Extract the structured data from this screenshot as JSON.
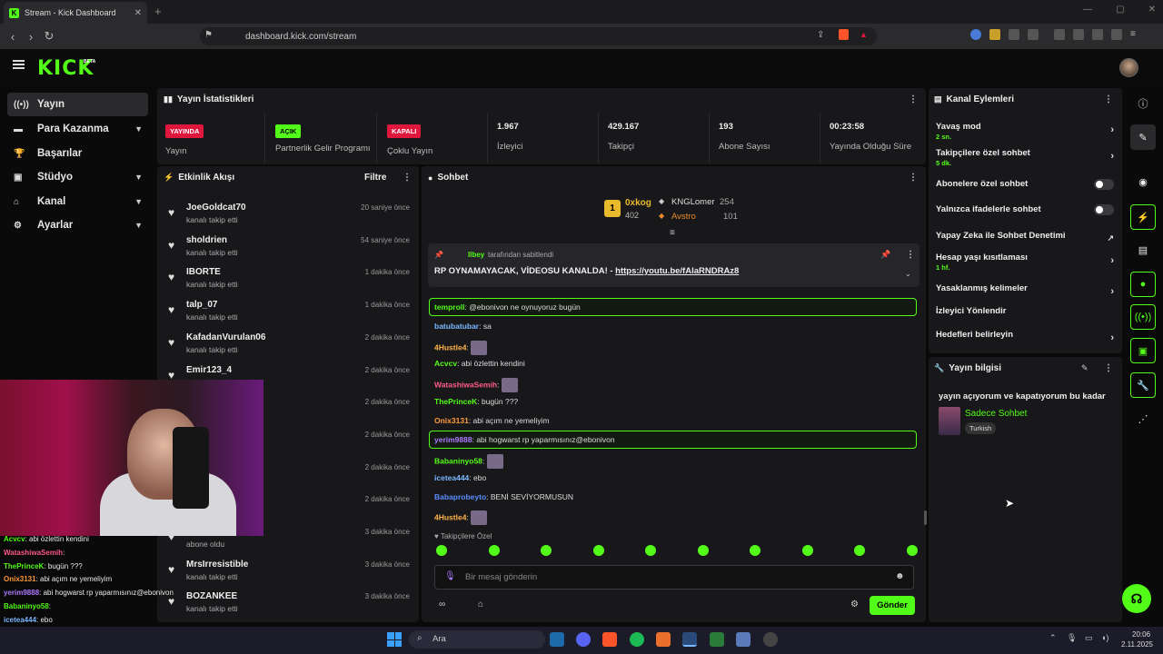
{
  "browser": {
    "tab_title": "Stream - Kick Dashboard",
    "url": "dashboard.kick.com/stream"
  },
  "brand": {
    "logo": "KICK",
    "beta": "BETA",
    "accent": "#53fc18"
  },
  "sidebar": {
    "items": [
      {
        "label": "Yayın",
        "icon": "broadcast-icon"
      },
      {
        "label": "Para Kazanma",
        "icon": "money-icon"
      },
      {
        "label": "Başarılar",
        "icon": "trophy-icon"
      },
      {
        "label": "Stüdyo",
        "icon": "studio-icon"
      },
      {
        "label": "Kanal",
        "icon": "channel-icon"
      },
      {
        "label": "Ayarlar",
        "icon": "gear-icon"
      }
    ]
  },
  "stats": {
    "title": "Yayın İstatistikleri",
    "cells": [
      {
        "badge": "YAYINDA",
        "badge_color": "#e0173d",
        "label": "Yayın"
      },
      {
        "badge": "AÇIK",
        "badge_color": "#53fc18",
        "label": "Partnerlik Gelir Programı"
      },
      {
        "badge": "KAPALI",
        "badge_color": "#e0173d",
        "label": "Çoklu Yayın"
      },
      {
        "value": "1.967",
        "label": "İzleyici"
      },
      {
        "value": "429.167",
        "label": "Takipçi"
      },
      {
        "value": "193",
        "label": "Abone Sayısı"
      },
      {
        "value": "00:23:58",
        "label": "Yayında Olduğu Süre"
      }
    ]
  },
  "activity": {
    "title": "Etkinlik Akışı",
    "filter": "Filtre",
    "items": [
      {
        "name": "JoeGoldcat70",
        "sub": "kanalı takip etti",
        "time": "20 saniye önce"
      },
      {
        "name": "sholdrien",
        "sub": "kanalı takip etti",
        "time": "54 saniye önce"
      },
      {
        "name": "IBORTE",
        "sub": "kanalı takip etti",
        "time": "1 dakika önce"
      },
      {
        "name": "talp_07",
        "sub": "kanalı takip etti",
        "time": "1 dakika önce"
      },
      {
        "name": "KafadanVurulan06",
        "sub": "kanalı takip etti",
        "time": "2 dakika önce"
      },
      {
        "name": "Emir123_4",
        "sub": "kanalı takip etti",
        "time": "2 dakika önce"
      },
      {
        "name": "",
        "sub": "",
        "time": "2 dakika önce"
      },
      {
        "name": "",
        "sub": "",
        "time": "2 dakika önce"
      },
      {
        "name": "",
        "sub": "",
        "time": "2 dakika önce"
      },
      {
        "name": "",
        "sub": "",
        "time": "2 dakika önce"
      },
      {
        "name": "",
        "sub": "abone oldu",
        "time": "3 dakika önce"
      },
      {
        "name": "MrsIrresistible",
        "sub": "kanalı takip etti",
        "time": "3 dakika önce"
      },
      {
        "name": "BOZANKEE",
        "sub": "kanalı takip etti",
        "time": "3 dakika önce"
      }
    ]
  },
  "chat": {
    "title": "Sohbet",
    "leader": {
      "rank": "1",
      "name1": "0xkog",
      "val1": "402",
      "name2": "KNGLomer",
      "val2": "254",
      "name3": "Avstro",
      "val3": "101"
    },
    "pinned": {
      "by": "llbey",
      "by_suffix": "tarafından sabitlendi",
      "text": "RP OYNAMAYACAK, VİDEOSU KANALDA! - ",
      "link": "https://youtu.be/fAlaRNDRAz8"
    },
    "messages": [
      {
        "user": "temproll",
        "color": "#53fc18",
        "text": "@ebonivon ne oynuyoruz bugün",
        "highlight": true
      },
      {
        "user": "batubatubar",
        "color": "#7ab8ff",
        "text": "sa"
      },
      {
        "user": "4Hustle4",
        "color": "#ffb347",
        "text": "",
        "emote": true
      },
      {
        "user": "Acvcv",
        "color": "#53fc18",
        "text": "abi özlettin kendini"
      },
      {
        "user": "WatashiwaSemih",
        "color": "#ff5c8a",
        "text": "",
        "emote": true
      },
      {
        "user": "ThePrinceK",
        "color": "#53fc18",
        "text": "bugün ???"
      },
      {
        "user": "Onix3131",
        "color": "#ff9a3c",
        "text": "abi açım ne yemeliyim"
      },
      {
        "user": "yerim9888",
        "color": "#b07bff",
        "text": "abi hogwarst rp yaparmısınız@ebonivon",
        "highlight": true
      },
      {
        "user": "Babaninyo58",
        "color": "#53fc18",
        "text": "",
        "emote": true
      },
      {
        "user": "icetea444",
        "color": "#7ab8ff",
        "text": "ebo"
      },
      {
        "user": "Babaprobeyto",
        "color": "#5a8cff",
        "text": "BENİ SEVİYORMUSUN"
      },
      {
        "user": "4Hustle4",
        "color": "#ffb347",
        "text": "",
        "emote": true
      }
    ],
    "followers_only": "Takipçilere Özel",
    "input_placeholder": "Bir mesaj gönderin",
    "send": "Gönder"
  },
  "actions": {
    "title": "Kanal Eylemleri",
    "items": [
      {
        "label": "Yavaş mod",
        "sub": "2 sn.",
        "control": "chevron"
      },
      {
        "label": "Takipçilere özel sohbet",
        "sub": "5 dk.",
        "control": "chevron"
      },
      {
        "label": "Abonelere özel sohbet",
        "sub": "",
        "control": "toggle"
      },
      {
        "label": "Yalnızca ifadelerle sohbet",
        "sub": "",
        "control": "toggle"
      },
      {
        "label": "Yapay Zeka ile Sohbet Denetimi",
        "sub": "",
        "control": "external"
      },
      {
        "label": "Hesap yaşı kısıtlaması",
        "sub": "1 hf.",
        "control": "chevron"
      },
      {
        "label": "Yasaklanmış kelimeler",
        "sub": "",
        "control": "chevron"
      },
      {
        "label": "İzleyici Yönlendir",
        "sub": "",
        "control": "none"
      },
      {
        "label": "Hedefleri belirleyin",
        "sub": "",
        "control": "chevron"
      }
    ]
  },
  "streaminfo": {
    "title": "Yayın bilgisi",
    "text": "yayın açıyorum ve kapatıyorum bu kadar",
    "category": "Sadece Sohbet",
    "tag": "Turkish"
  },
  "overlay": {
    "lines": [
      {
        "user": "Acvcv",
        "color": "#53fc18",
        "text": ": abi özlettin kendini"
      },
      {
        "user": "WatashiwaSemih",
        "color": "#ff5c8a",
        "text": ":"
      },
      {
        "user": "ThePrinceK",
        "color": "#53fc18",
        "text": ": bugün ???"
      },
      {
        "user": "Onix3131",
        "color": "#ff9a3c",
        "text": ": abi açım ne yemeliyim"
      },
      {
        "user": "yerim9888",
        "color": "#b07bff",
        "text": ": abi hogwarst rp yaparmısınız@ebonivon"
      },
      {
        "user": "Babaninyo58",
        "color": "#53fc18",
        "text": ":"
      },
      {
        "user": "icetea444",
        "color": "#7ab8ff",
        "text": ": ebo"
      },
      {
        "user": "Babaprobeyto",
        "color": "#5a8cff",
        "text": ": BENİ SEVİYORMUSUN"
      },
      {
        "user": "4Hustle4",
        "color": "#ffb347",
        "text": ":"
      }
    ]
  },
  "taskbar": {
    "search": "Ara",
    "time": "20:06",
    "date": "2.11.2025"
  }
}
